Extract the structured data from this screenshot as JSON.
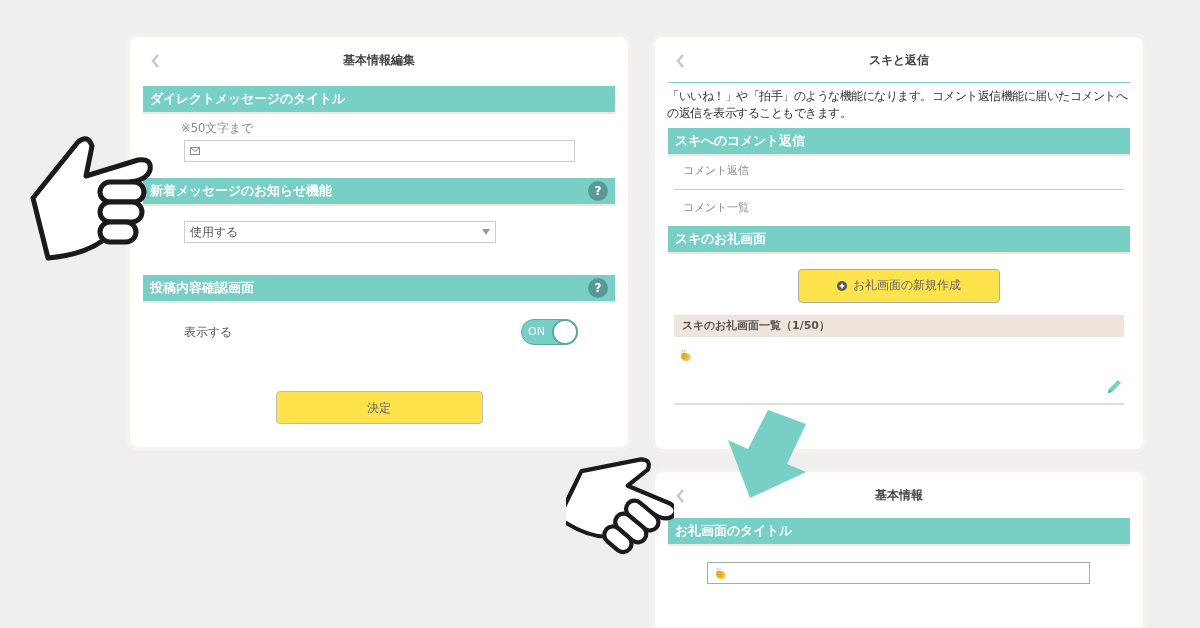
{
  "edit_screen": {
    "title": "基本情報編集",
    "sections": [
      {
        "kind": "text_input",
        "heading": "ダイレクトメッセージのタイトル",
        "hint": "※50文字まで"
      },
      {
        "kind": "select",
        "heading": "新着メッセージのお知らせ機能",
        "help": "?",
        "value": "使用する"
      },
      {
        "kind": "toggle",
        "heading": "投稿内容確認画面",
        "help": "?",
        "label": "表示する",
        "on": true,
        "toggle_text": "ON"
      }
    ],
    "submit": "決定"
  },
  "like_screen": {
    "title": "スキと返信",
    "description": "「いいね！」や「拍手」のような機能になります。コメント返信機能に届いたコメントへの返信を表示することもできます。",
    "reply_heading": "スキへのコメント返信",
    "reply_links": [
      "コメント返信",
      "コメント一覧"
    ],
    "thanks_heading": "スキのお礼画面",
    "create_button": "お礼画面の新規作成",
    "list_heading": "スキのお礼画面一覧（1/50）"
  },
  "info_screen": {
    "title": "基本情報",
    "heading": "お礼画面のタイトル"
  }
}
